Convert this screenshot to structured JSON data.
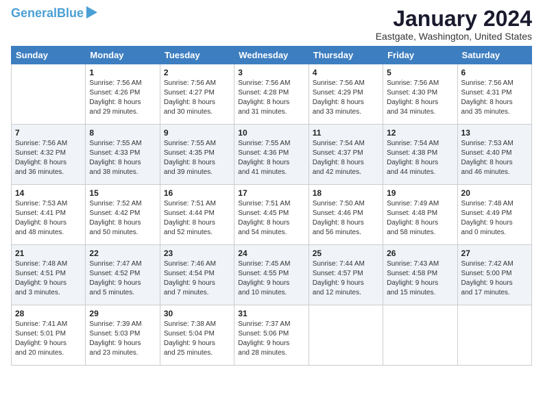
{
  "logo": {
    "part1": "General",
    "part2": "Blue"
  },
  "title": "January 2024",
  "location": "Eastgate, Washington, United States",
  "days": [
    "Sunday",
    "Monday",
    "Tuesday",
    "Wednesday",
    "Thursday",
    "Friday",
    "Saturday"
  ],
  "weeks": [
    [
      {
        "date": "",
        "content": ""
      },
      {
        "date": "1",
        "content": "Sunrise: 7:56 AM\nSunset: 4:26 PM\nDaylight: 8 hours\nand 29 minutes."
      },
      {
        "date": "2",
        "content": "Sunrise: 7:56 AM\nSunset: 4:27 PM\nDaylight: 8 hours\nand 30 minutes."
      },
      {
        "date": "3",
        "content": "Sunrise: 7:56 AM\nSunset: 4:28 PM\nDaylight: 8 hours\nand 31 minutes."
      },
      {
        "date": "4",
        "content": "Sunrise: 7:56 AM\nSunset: 4:29 PM\nDaylight: 8 hours\nand 33 minutes."
      },
      {
        "date": "5",
        "content": "Sunrise: 7:56 AM\nSunset: 4:30 PM\nDaylight: 8 hours\nand 34 minutes."
      },
      {
        "date": "6",
        "content": "Sunrise: 7:56 AM\nSunset: 4:31 PM\nDaylight: 8 hours\nand 35 minutes."
      }
    ],
    [
      {
        "date": "7",
        "content": "Sunrise: 7:56 AM\nSunset: 4:32 PM\nDaylight: 8 hours\nand 36 minutes."
      },
      {
        "date": "8",
        "content": "Sunrise: 7:55 AM\nSunset: 4:33 PM\nDaylight: 8 hours\nand 38 minutes."
      },
      {
        "date": "9",
        "content": "Sunrise: 7:55 AM\nSunset: 4:35 PM\nDaylight: 8 hours\nand 39 minutes."
      },
      {
        "date": "10",
        "content": "Sunrise: 7:55 AM\nSunset: 4:36 PM\nDaylight: 8 hours\nand 41 minutes."
      },
      {
        "date": "11",
        "content": "Sunrise: 7:54 AM\nSunset: 4:37 PM\nDaylight: 8 hours\nand 42 minutes."
      },
      {
        "date": "12",
        "content": "Sunrise: 7:54 AM\nSunset: 4:38 PM\nDaylight: 8 hours\nand 44 minutes."
      },
      {
        "date": "13",
        "content": "Sunrise: 7:53 AM\nSunset: 4:40 PM\nDaylight: 8 hours\nand 46 minutes."
      }
    ],
    [
      {
        "date": "14",
        "content": "Sunrise: 7:53 AM\nSunset: 4:41 PM\nDaylight: 8 hours\nand 48 minutes."
      },
      {
        "date": "15",
        "content": "Sunrise: 7:52 AM\nSunset: 4:42 PM\nDaylight: 8 hours\nand 50 minutes."
      },
      {
        "date": "16",
        "content": "Sunrise: 7:51 AM\nSunset: 4:44 PM\nDaylight: 8 hours\nand 52 minutes."
      },
      {
        "date": "17",
        "content": "Sunrise: 7:51 AM\nSunset: 4:45 PM\nDaylight: 8 hours\nand 54 minutes."
      },
      {
        "date": "18",
        "content": "Sunrise: 7:50 AM\nSunset: 4:46 PM\nDaylight: 8 hours\nand 56 minutes."
      },
      {
        "date": "19",
        "content": "Sunrise: 7:49 AM\nSunset: 4:48 PM\nDaylight: 8 hours\nand 58 minutes."
      },
      {
        "date": "20",
        "content": "Sunrise: 7:48 AM\nSunset: 4:49 PM\nDaylight: 9 hours\nand 0 minutes."
      }
    ],
    [
      {
        "date": "21",
        "content": "Sunrise: 7:48 AM\nSunset: 4:51 PM\nDaylight: 9 hours\nand 3 minutes."
      },
      {
        "date": "22",
        "content": "Sunrise: 7:47 AM\nSunset: 4:52 PM\nDaylight: 9 hours\nand 5 minutes."
      },
      {
        "date": "23",
        "content": "Sunrise: 7:46 AM\nSunset: 4:54 PM\nDaylight: 9 hours\nand 7 minutes."
      },
      {
        "date": "24",
        "content": "Sunrise: 7:45 AM\nSunset: 4:55 PM\nDaylight: 9 hours\nand 10 minutes."
      },
      {
        "date": "25",
        "content": "Sunrise: 7:44 AM\nSunset: 4:57 PM\nDaylight: 9 hours\nand 12 minutes."
      },
      {
        "date": "26",
        "content": "Sunrise: 7:43 AM\nSunset: 4:58 PM\nDaylight: 9 hours\nand 15 minutes."
      },
      {
        "date": "27",
        "content": "Sunrise: 7:42 AM\nSunset: 5:00 PM\nDaylight: 9 hours\nand 17 minutes."
      }
    ],
    [
      {
        "date": "28",
        "content": "Sunrise: 7:41 AM\nSunset: 5:01 PM\nDaylight: 9 hours\nand 20 minutes."
      },
      {
        "date": "29",
        "content": "Sunrise: 7:39 AM\nSunset: 5:03 PM\nDaylight: 9 hours\nand 23 minutes."
      },
      {
        "date": "30",
        "content": "Sunrise: 7:38 AM\nSunset: 5:04 PM\nDaylight: 9 hours\nand 25 minutes."
      },
      {
        "date": "31",
        "content": "Sunrise: 7:37 AM\nSunset: 5:06 PM\nDaylight: 9 hours\nand 28 minutes."
      },
      {
        "date": "",
        "content": ""
      },
      {
        "date": "",
        "content": ""
      },
      {
        "date": "",
        "content": ""
      }
    ]
  ]
}
